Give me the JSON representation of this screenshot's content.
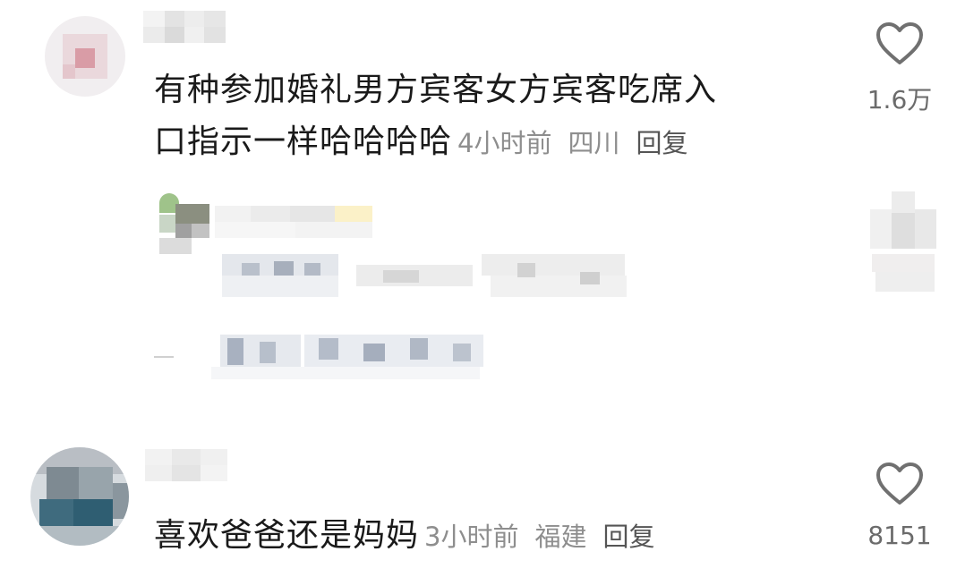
{
  "comments": [
    {
      "text_line1": "有种参加婚礼男方宾客女方宾客吃席入",
      "text_line2": "口指示一样哈哈哈哈",
      "time": "4小时前",
      "location": "四川",
      "reply_label": "回复",
      "likes": "1.6万"
    },
    {
      "text": "喜欢爸爸还是妈妈",
      "time": "3小时前",
      "location": "福建",
      "reply_label": "回复",
      "likes": "8151"
    }
  ],
  "colors": {
    "text": "#1a1a1a",
    "meta": "#8e8e8e",
    "like_icon": "#707070"
  },
  "icons": {
    "like": "heart-outline-icon"
  }
}
